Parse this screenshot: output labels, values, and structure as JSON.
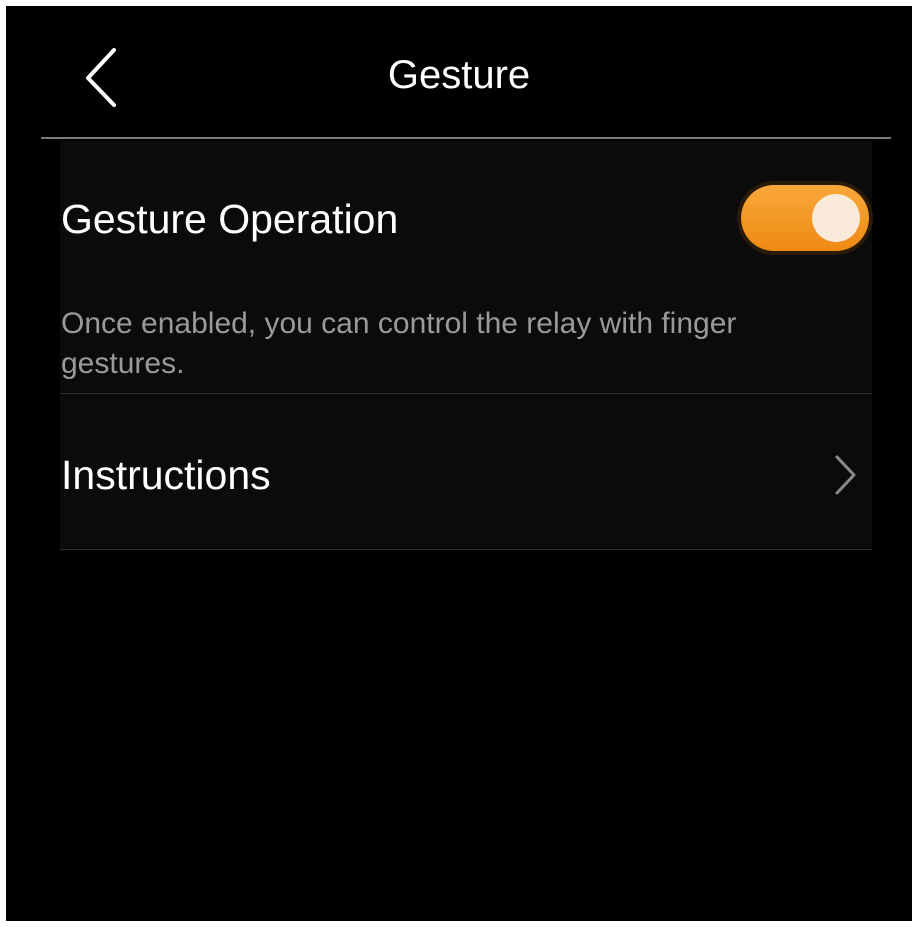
{
  "header": {
    "title": "Gesture",
    "back_icon": "chevron-left-icon"
  },
  "settings": {
    "gesture_operation": {
      "label": "Gesture Operation",
      "enabled": true,
      "description": "Once enabled, you can control the relay with finger gestures."
    },
    "instructions": {
      "label": "Instructions",
      "icon": "chevron-right-icon"
    }
  },
  "colors": {
    "background": "#000000",
    "card": "#0b0b0b",
    "accent": "#f39a23",
    "knob": "#fbe9da",
    "description_text": "#9a9a9a"
  }
}
